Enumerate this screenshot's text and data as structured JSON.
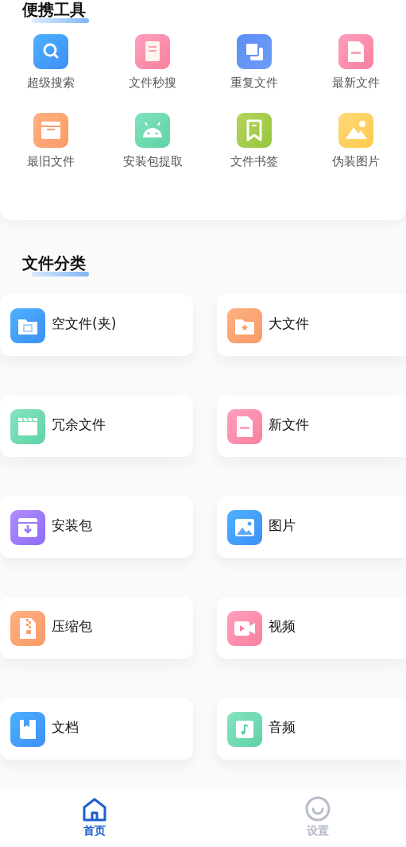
{
  "portable_tools": {
    "title": "便携工具",
    "items": [
      {
        "label": "超级搜索"
      },
      {
        "label": "文件秒搜"
      },
      {
        "label": "重复文件"
      },
      {
        "label": "最新文件"
      },
      {
        "label": "最旧文件"
      },
      {
        "label": "安装包提取"
      },
      {
        "label": "文件书签"
      },
      {
        "label": "伪装图片"
      }
    ]
  },
  "file_categories": {
    "title": "文件分类",
    "items": [
      {
        "label": "空文件(夹)"
      },
      {
        "label": "大文件"
      },
      {
        "label": "冗余文件"
      },
      {
        "label": "新文件"
      },
      {
        "label": "安装包"
      },
      {
        "label": "图片"
      },
      {
        "label": "压缩包"
      },
      {
        "label": "视频"
      },
      {
        "label": "文档"
      },
      {
        "label": "音频"
      }
    ]
  },
  "bottom_nav": [
    {
      "label": "首页",
      "selected": true
    },
    {
      "label": "设置",
      "selected": false
    }
  ]
}
